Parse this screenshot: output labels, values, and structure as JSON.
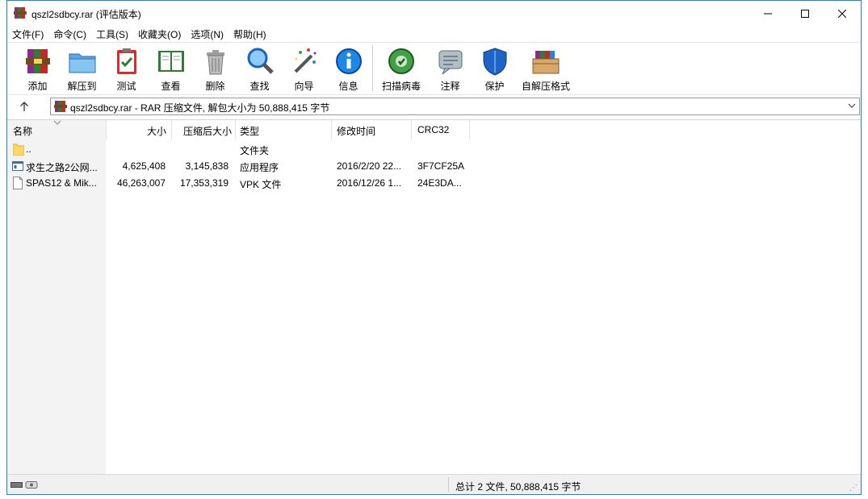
{
  "window": {
    "title": "qszl2sdbcy.rar (评估版本)",
    "accent": "#1883d7"
  },
  "menu": [
    "文件(F)",
    "命令(C)",
    "工具(S)",
    "收藏夹(O)",
    "选项(N)",
    "帮助(H)"
  ],
  "toolbar": {
    "add": "添加",
    "extract": "解压到",
    "test": "测试",
    "view": "查看",
    "delete": "删除",
    "find": "查找",
    "wizard": "向导",
    "info": "信息",
    "scan": "扫描病毒",
    "comment": "注释",
    "protect": "保护",
    "sfx": "自解压格式"
  },
  "address": {
    "text": "qszl2sdbcy.rar - RAR 压缩文件, 解包大小为 50,888,415 字节"
  },
  "columns": {
    "name": "名称",
    "size": "大小",
    "packed": "压缩后大小",
    "type": "类型",
    "modified": "修改时间",
    "crc": "CRC32"
  },
  "files": [
    {
      "name": "..",
      "size": "",
      "packed": "",
      "type": "文件夹",
      "modified": "",
      "crc": "",
      "icon": "folder-icon"
    },
    {
      "name": "求生之路2公网...",
      "size": "4,625,408",
      "packed": "3,145,838",
      "type": "应用程序",
      "modified": "2016/2/20 22...",
      "crc": "3F7CF25A",
      "icon": "exe-icon"
    },
    {
      "name": "SPAS12 & Mik...",
      "size": "46,263,007",
      "packed": "17,353,319",
      "type": "VPK 文件",
      "modified": "2016/12/26 1...",
      "crc": "24E3DA...",
      "icon": "file-icon"
    }
  ],
  "status": {
    "summary": "总计 2 文件, 50,888,415 字节"
  }
}
